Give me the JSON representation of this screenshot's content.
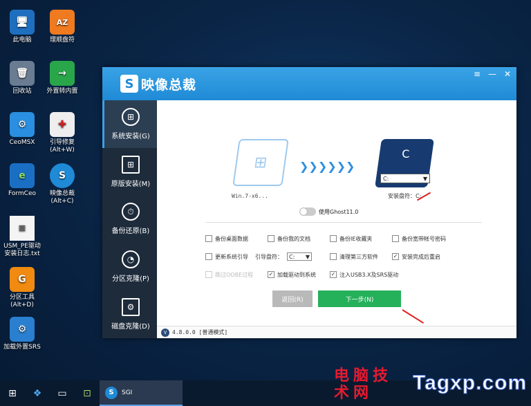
{
  "desktop": {
    "icons": [
      {
        "label": "此电脑",
        "glyph": "🖥"
      },
      {
        "label": "理顺盘符",
        "glyph": "AZ"
      },
      {
        "label": "回收站",
        "glyph": "🗑"
      },
      {
        "label": "外置转内置",
        "glyph": "→"
      },
      {
        "label": "CeoMSX",
        "glyph": "⚙"
      },
      {
        "label": "引导修复\n(Alt+W)",
        "glyph": "✚"
      },
      {
        "label": "FormCeo",
        "glyph": "e"
      },
      {
        "label": "映像总裁\n(Alt+C)",
        "glyph": "S"
      },
      {
        "label": "USM_PE驱动\n安装日志.txt",
        "glyph": "≡"
      },
      {
        "label": "分区工具\n(Alt+D)",
        "glyph": "G"
      },
      {
        "label": "加载外置SRS",
        "glyph": "⚙"
      }
    ]
  },
  "window": {
    "logo_mark": "S",
    "title": "映像总裁",
    "controls": {
      "menu": "≡",
      "minimize": "—",
      "close": "✕"
    },
    "sidebar": [
      {
        "label": "系统安装(G)",
        "icon": "⊞"
      },
      {
        "label": "原版安装(M)",
        "icon": "⊞"
      },
      {
        "label": "备份还原(B)",
        "icon": "⏱"
      },
      {
        "label": "分区克隆(P)",
        "icon": "◔"
      },
      {
        "label": "磁盘克隆(D)",
        "icon": "⚙"
      }
    ],
    "source": {
      "icon": "⊞",
      "label": "Win.7-x6..."
    },
    "arrows": "❯❯❯❯❯❯",
    "target": {
      "letter": "C",
      "select_value": "C:",
      "label": "安装盘符：C:"
    },
    "ghost_toggle_label": "使用Ghost11.0",
    "options_row1": [
      {
        "label": "备份桌面数据",
        "checked": "",
        "disabled": false
      },
      {
        "label": "备份我的文档",
        "checked": "",
        "disabled": false
      },
      {
        "label": "备份IE收藏夹",
        "checked": "",
        "disabled": false
      },
      {
        "label": "备份宽带帐号密码",
        "checked": "",
        "disabled": false
      }
    ],
    "options_row2": {
      "fix_boot": {
        "label": "更新系统引导",
        "checked": ""
      },
      "boot_drive_label": "引导盘符：",
      "boot_drive_value": "C:",
      "clean_third": {
        "label": "清理第三方软件",
        "checked": ""
      },
      "restart_after": {
        "label": "安装完成后重启",
        "checked": "✓"
      }
    },
    "options_row3": [
      {
        "label": "跳过OOBE过程",
        "checked": "",
        "disabled": true
      },
      {
        "label": "加载驱动到系统",
        "checked": "✓",
        "disabled": false
      },
      {
        "label": "注入USB3.X及SRS驱动",
        "checked": "✓",
        "disabled": false
      }
    ],
    "buttons": {
      "back": "返回(R)",
      "next": "下一步(N)"
    },
    "status": {
      "badge": "V",
      "text": "4.8.0.0 [普通模式]"
    }
  },
  "taskbar": {
    "start": "⊞",
    "items": [
      "❖",
      "▭",
      "⊡"
    ],
    "active_app": {
      "icon": "S",
      "label": "SGI"
    }
  },
  "watermark": {
    "cn": "电脑技术网",
    "en": "Tagxp.com"
  }
}
